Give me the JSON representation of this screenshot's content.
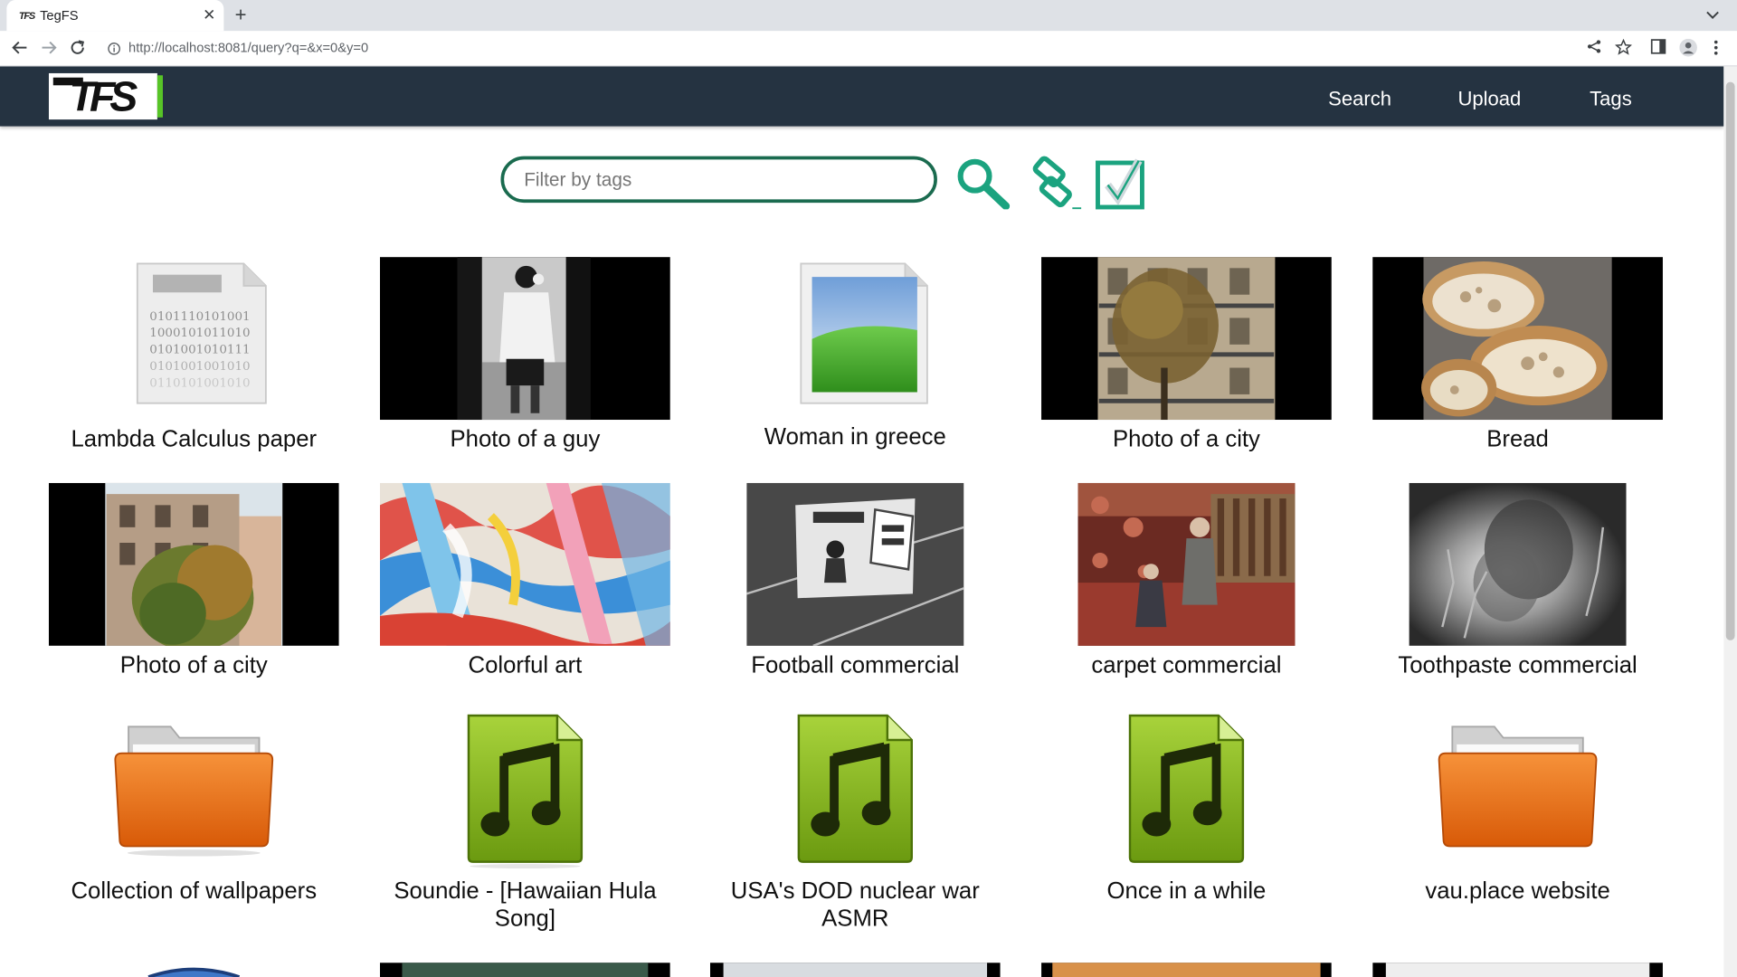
{
  "browser": {
    "tab_title": "TegFS",
    "favicon_text": "TFS",
    "url": "http://localhost:8081/query?q=&x=0&y=0"
  },
  "app": {
    "logo_text": "TFS",
    "nav": {
      "search": "Search",
      "upload": "Upload",
      "tags": "Tags"
    },
    "filter_placeholder": "Filter by tags"
  },
  "gallery": [
    {
      "title": "Lambda Calculus paper",
      "kind": "binary-document",
      "binary_text": [
        "0101110101001",
        "1000101011010",
        "0101001010111",
        "0101001001010",
        "0110101001010"
      ]
    },
    {
      "title": "Photo of a guy",
      "kind": "photo"
    },
    {
      "title": "Woman in greece",
      "kind": "image-file"
    },
    {
      "title": "Photo of a city",
      "kind": "photo"
    },
    {
      "title": "Bread",
      "kind": "photo"
    },
    {
      "title": "Photo of a city",
      "kind": "photo"
    },
    {
      "title": "Colorful art",
      "kind": "photo"
    },
    {
      "title": "Football commercial",
      "kind": "video"
    },
    {
      "title": "carpet commercial",
      "kind": "video"
    },
    {
      "title": "Toothpaste commercial",
      "kind": "video"
    },
    {
      "title": "Collection of wallpapers",
      "kind": "folder"
    },
    {
      "title": "Soundie - [Hawaiian Hula Song]",
      "kind": "audio"
    },
    {
      "title": "USA's DOD nuclear war ASMR",
      "kind": "audio"
    },
    {
      "title": "Once in a while",
      "kind": "audio"
    },
    {
      "title": "vau.place website",
      "kind": "folder"
    }
  ],
  "colors": {
    "navbar": "#253341",
    "accent_green": "#1ba37f",
    "folder_orange": "#e8670e",
    "audio_green": "#7cab17"
  }
}
